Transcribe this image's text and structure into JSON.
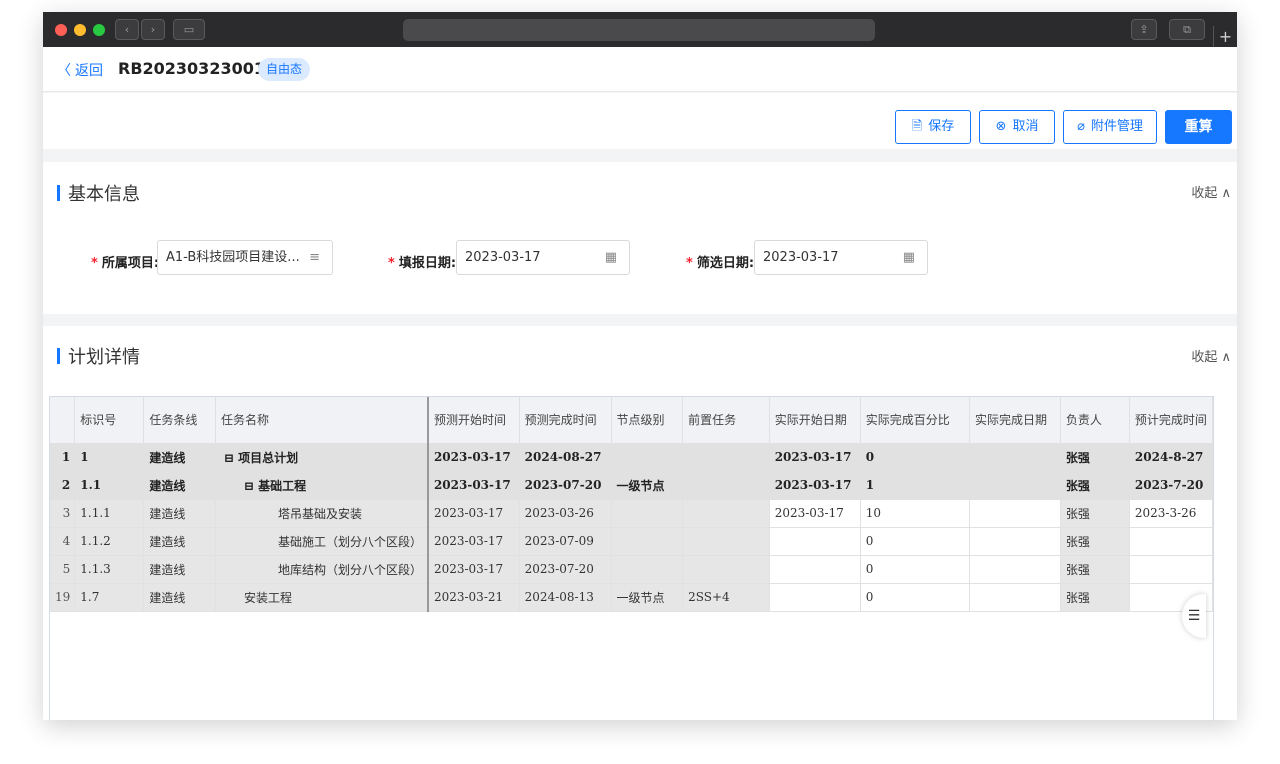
{
  "header": {
    "back_label": "返回",
    "doc_no": "RB20230323001",
    "status": "自由态"
  },
  "toolbar": {
    "save_label": "保存",
    "cancel_label": "取消",
    "attach_label": "附件管理",
    "recalc_label": "重算"
  },
  "basic": {
    "title": "基本信息",
    "collapse_label": "收起",
    "project_label": "所属项目:",
    "project_value": "A1-B科技园项目建设...",
    "report_date_label": "填报日期:",
    "report_date_value": "2023-03-17",
    "filter_date_label": "筛选日期:",
    "filter_date_value": "2023-03-17"
  },
  "plan": {
    "title": "计划详情",
    "collapse_label": "收起",
    "columns": [
      "标识号",
      "任务条线",
      "任务名称",
      "预测开始时间",
      "预测完成时间",
      "节点级别",
      "前置任务",
      "实际开始日期",
      "实际完成百分比",
      "实际完成日期",
      "负责人",
      "预计完成时间"
    ],
    "rows": [
      {
        "idx": "1",
        "code": "1",
        "line": "建造线",
        "name": "⊟ 项目总计划",
        "pstart": "2023-03-17",
        "pend": "2024-08-27",
        "level": "",
        "pred": "",
        "astart": "2023-03-17",
        "pct": "0",
        "aend": "",
        "owner": "张强",
        "eend": "2024-8-27",
        "bold": true,
        "indent": 0
      },
      {
        "idx": "2",
        "code": "1.1",
        "line": "建造线",
        "name": "⊟ 基础工程",
        "pstart": "2023-03-17",
        "pend": "2023-07-20",
        "level": "一级节点",
        "pred": "",
        "astart": "2023-03-17",
        "pct": "1",
        "aend": "",
        "owner": "张强",
        "eend": "2023-7-20",
        "bold": true,
        "indent": 1
      },
      {
        "idx": "3",
        "code": "1.1.1",
        "line": "建造线",
        "name": "塔吊基础及安装",
        "pstart": "2023-03-17",
        "pend": "2023-03-26",
        "level": "",
        "pred": "",
        "astart": "2023-03-17",
        "pct": "10",
        "aend": "",
        "owner": "张强",
        "eend": "2023-3-26",
        "bold": false,
        "indent": 2
      },
      {
        "idx": "4",
        "code": "1.1.2",
        "line": "建造线",
        "name": "基础施工（划分八个区段）",
        "pstart": "2023-03-17",
        "pend": "2023-07-09",
        "level": "",
        "pred": "",
        "astart": "",
        "pct": "0",
        "aend": "",
        "owner": "张强",
        "eend": "",
        "bold": false,
        "indent": 2
      },
      {
        "idx": "5",
        "code": "1.1.3",
        "line": "建造线",
        "name": "地库结构（划分八个区段）",
        "pstart": "2023-03-17",
        "pend": "2023-07-20",
        "level": "",
        "pred": "",
        "astart": "",
        "pct": "0",
        "aend": "",
        "owner": "张强",
        "eend": "",
        "bold": false,
        "indent": 2
      },
      {
        "idx": "19",
        "code": "1.7",
        "line": "建造线",
        "name": "安装工程",
        "pstart": "2023-03-21",
        "pend": "2024-08-13",
        "level": "一级节点",
        "pred": "2SS+4",
        "astart": "",
        "pct": "0",
        "aend": "",
        "owner": "张强",
        "eend": "",
        "bold": false,
        "indent": 1
      }
    ]
  },
  "colors": {
    "accent": "#1677ff",
    "required": "#f5222d",
    "readonly_cell": "#e6e6e6"
  },
  "icons": {
    "back": "chevron-left-icon",
    "save": "save-icon",
    "cancel": "cancel-circle-icon",
    "attach": "paperclip-icon",
    "filter": "filter-icon",
    "calendar": "calendar-icon",
    "collapse": "chevron-up-icon"
  }
}
